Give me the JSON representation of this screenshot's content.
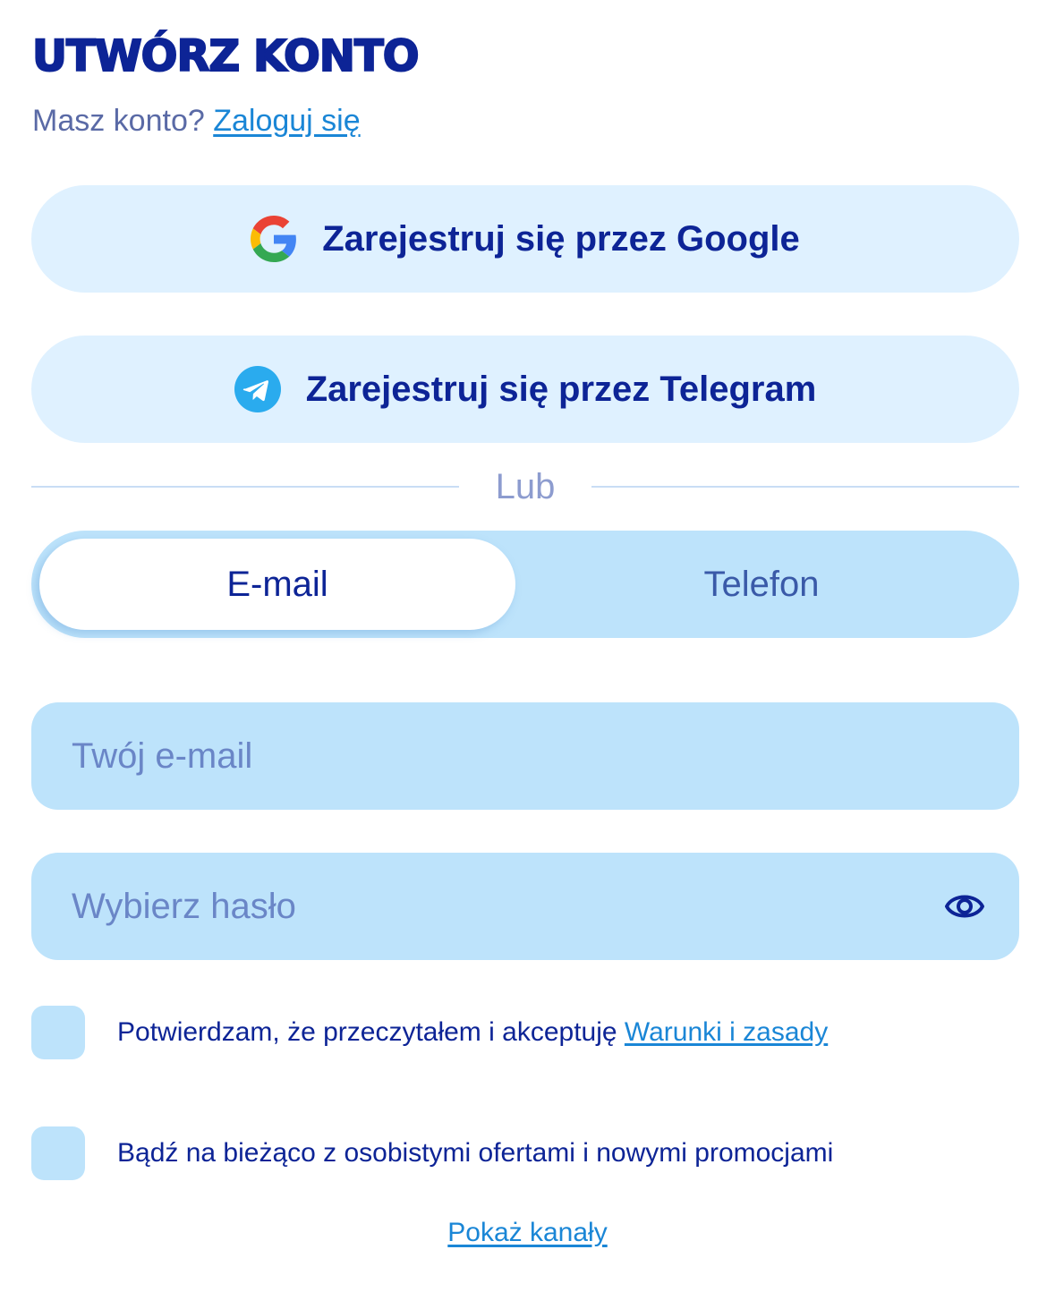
{
  "header": {
    "title": "UTWÓRZ KONTO",
    "prompt_text": "Masz konto? ",
    "login_link": "Zaloguj się"
  },
  "social": {
    "google": {
      "label": "Zarejestruj się przez Google",
      "icon": "google-icon"
    },
    "telegram": {
      "label": "Zarejestruj się przez Telegram",
      "icon": "telegram-icon"
    }
  },
  "divider": {
    "text": "Lub"
  },
  "method_toggle": {
    "options": [
      "E-mail",
      "Telefon"
    ],
    "selected": "E-mail"
  },
  "form": {
    "email": {
      "placeholder": "Twój e-mail",
      "value": ""
    },
    "password": {
      "placeholder": "Wybierz hasło",
      "value": "",
      "toggle_icon": "eye-icon"
    }
  },
  "consents": {
    "terms": {
      "text": "Potwierdzam, że przeczytałem i akceptuję ",
      "link": "Warunki i zasady",
      "checked": false
    },
    "promotions": {
      "text": "Bądź na bieżąco z osobistymi ofertami i nowymi promocjami",
      "checked": false
    }
  },
  "footer": {
    "show_channels_link": "Pokaż kanały"
  },
  "colors": {
    "primary_text": "#0d2496",
    "link": "#1a86d6",
    "button_bg": "#dff1ff",
    "field_bg": "#bde3fb",
    "muted": "#5a6aa6"
  }
}
